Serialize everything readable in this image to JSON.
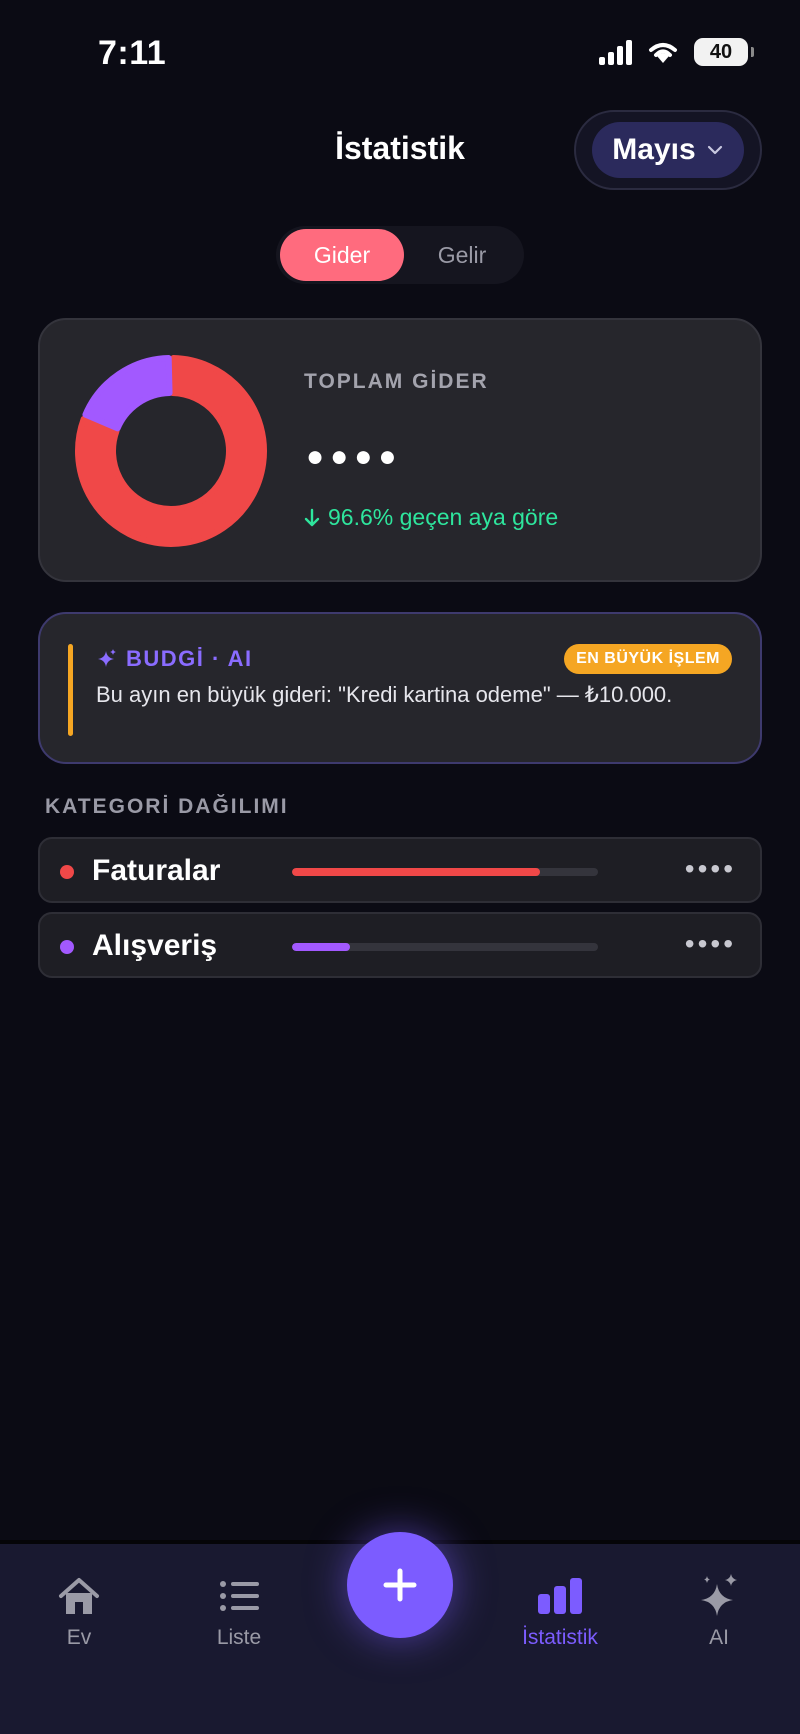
{
  "status": {
    "time": "7:11",
    "battery": "40"
  },
  "header": {
    "title": "İstatistik",
    "month": "Mayıs"
  },
  "segment": {
    "active": "Gider",
    "inactive": "Gelir"
  },
  "summary": {
    "label": "TOPLAM GİDER",
    "masked_value": "●●●●",
    "change": "96.6% geçen aya göre",
    "donut": [
      {
        "category": "Faturalar",
        "fraction": 0.81,
        "color": "#f04848"
      },
      {
        "category": "Alışveriş",
        "fraction": 0.19,
        "color": "#a259ff"
      }
    ]
  },
  "ai": {
    "title": "BUDGİ · AI",
    "badge": "EN BÜYÜK İŞLEM",
    "text": "Bu ayın en büyük gideri: \"Kredi kartina odeme\" — ₺10.000."
  },
  "categories": {
    "label": "KATEGORİ DAĞILIMI",
    "items": [
      {
        "name": "Faturalar",
        "color": "#f04848",
        "share": 0.81,
        "amount": "••••"
      },
      {
        "name": "Alışveriş",
        "color": "#a259ff",
        "share": 0.19,
        "amount": "••••"
      }
    ]
  },
  "nav": {
    "home": "Ev",
    "list": "Liste",
    "stats": "İstatistik",
    "ai": "AI"
  },
  "colors": {
    "accent": "#7c5cff",
    "expense": "#ff6b7e",
    "positive": "#2ee59d",
    "warning": "#f5a623"
  }
}
